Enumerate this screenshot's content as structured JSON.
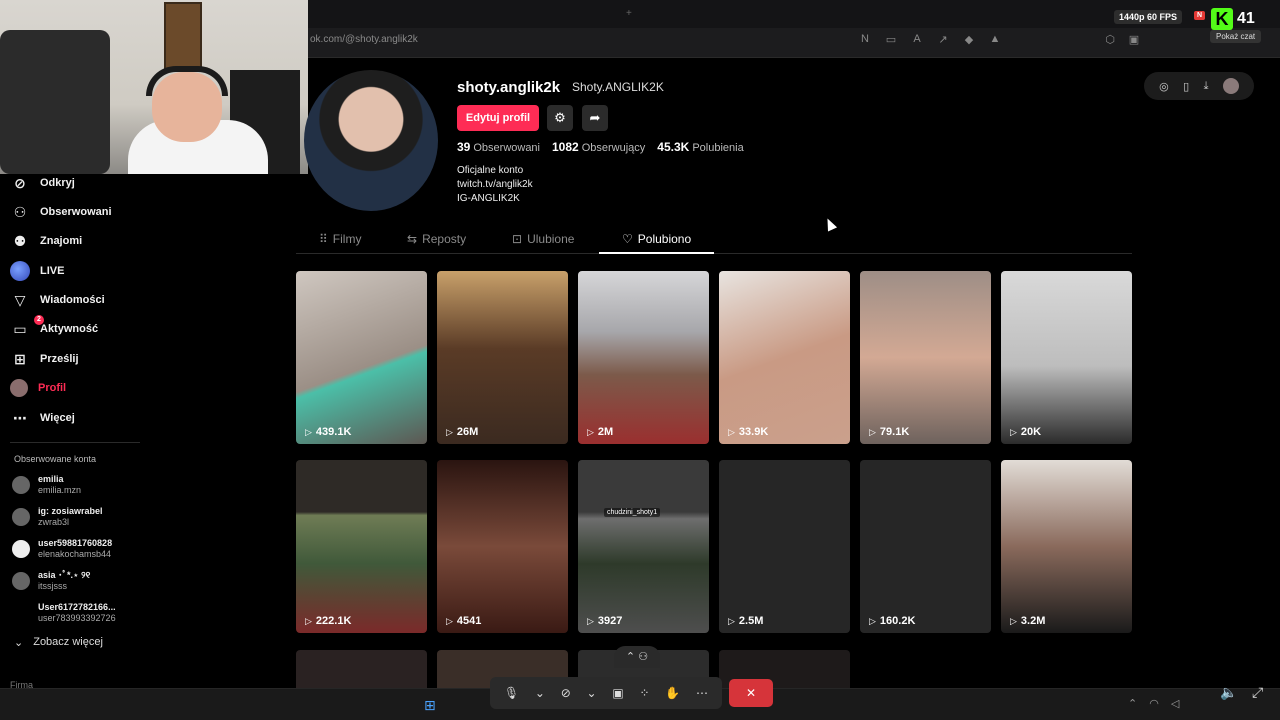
{
  "browser": {
    "url": "ok.com/@shoty.anglik2k",
    "fps_chip": "1440p 60 FPS",
    "n_chip": "N",
    "kick_logo": "K",
    "viewer_count": "41",
    "chat_pill": "Pokaż czat"
  },
  "sidebar": {
    "items": [
      {
        "label": "Odkryj",
        "icon": "compass-icon",
        "glyph": "⊘"
      },
      {
        "label": "Obserwowani",
        "icon": "user-follow-icon",
        "glyph": "⚇"
      },
      {
        "label": "Znajomi",
        "icon": "friends-icon",
        "glyph": "⚉"
      },
      {
        "label": "LIVE",
        "icon": "live-icon",
        "glyph": ""
      },
      {
        "label": "Wiadomości",
        "icon": "send-icon",
        "glyph": "▽"
      },
      {
        "label": "Aktywność",
        "icon": "activity-icon",
        "glyph": "▭",
        "badge": "2"
      },
      {
        "label": "Prześlij",
        "icon": "upload-icon",
        "glyph": "⊞"
      },
      {
        "label": "Profil",
        "icon": "profile-icon",
        "glyph": "",
        "active": true
      },
      {
        "label": "Więcej",
        "icon": "more-icon",
        "glyph": "⋯"
      }
    ],
    "followed_title": "Obserwowane konta",
    "followed": [
      {
        "name": "emilia",
        "handle": "emilia.mzn"
      },
      {
        "name": "ig: zosiawrabel",
        "handle": "zwrab3l"
      },
      {
        "name": "user59881760828",
        "handle": "elenakochamsb44"
      },
      {
        "name": "asia ･ﾟ*.⋆ ୨୧",
        "handle": "itssjsss"
      },
      {
        "name": "User6172782166...",
        "handle": "user783993392726"
      }
    ],
    "see_more": "Zobacz więcej",
    "footer": "Firma"
  },
  "profile": {
    "username": "shoty.anglik2k",
    "nickname": "Shoty.ANGLIK2K",
    "edit_button": "Edytuj profil",
    "following_count": "39",
    "following_label": "Obserwowani",
    "followers_count": "1082",
    "followers_label": "Obserwujący",
    "likes_count": "45.3K",
    "likes_label": "Polubienia",
    "bio_lines": [
      "Oficjalne konto",
      "twitch.tv/anglik2k",
      "IG-ANGLIK2K"
    ]
  },
  "tabs": [
    {
      "label": "Filmy",
      "icon": "grid-icon",
      "glyph": "⠿"
    },
    {
      "label": "Reposty",
      "icon": "repost-icon",
      "glyph": "⇆"
    },
    {
      "label": "Ulubione",
      "icon": "bookmark-icon",
      "glyph": "⊡"
    },
    {
      "label": "Polubiono",
      "icon": "heart-icon",
      "glyph": "♡",
      "active": true
    }
  ],
  "videos": [
    {
      "views": "439.1K"
    },
    {
      "views": "26M"
    },
    {
      "views": "2M"
    },
    {
      "views": "33.9K"
    },
    {
      "views": "79.1K"
    },
    {
      "views": "20K"
    },
    {
      "views": "222.1K"
    },
    {
      "views": "4541"
    },
    {
      "views": "3927",
      "tag": "chudzini_shoty1"
    },
    {
      "views": "2.5M"
    },
    {
      "views": "160.2K"
    },
    {
      "views": "3.2M"
    }
  ],
  "colors": {
    "accent": "#fe2c55",
    "background": "#000000"
  }
}
